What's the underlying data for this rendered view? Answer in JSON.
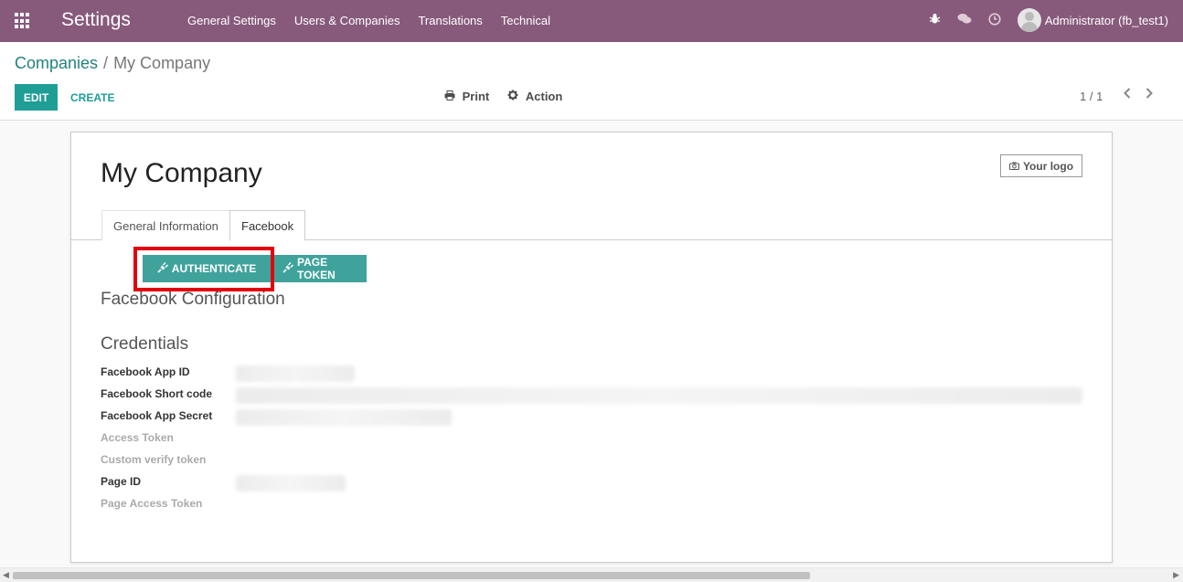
{
  "navbar": {
    "title": "Settings",
    "menu": [
      "General Settings",
      "Users & Companies",
      "Translations",
      "Technical"
    ],
    "user": "Administrator (fb_test1)"
  },
  "breadcrumb": {
    "parent": "Companies",
    "separator": "/",
    "current": "My Company"
  },
  "toolbar": {
    "edit_label": "EDIT",
    "create_label": "CREATE",
    "print_label": "Print",
    "action_label": "Action",
    "pager": "1 / 1"
  },
  "form": {
    "company_name": "My Company",
    "logo_label": "Your logo",
    "tabs": [
      "General Information",
      "Facebook"
    ],
    "buttons": {
      "authenticate": "AUTHENTICATE",
      "page_token": "PAGE TOKEN"
    },
    "section_facebook": "Facebook Configuration",
    "section_credentials": "Credentials",
    "fields": [
      {
        "label": "Facebook App ID"
      },
      {
        "label": "Facebook Short code"
      },
      {
        "label": "Facebook App Secret"
      },
      {
        "label": "Access Token"
      },
      {
        "label": "Custom verify token"
      },
      {
        "label": "Page ID"
      },
      {
        "label": "Page Access Token"
      }
    ]
  },
  "colors": {
    "navbar": "#875a7b",
    "primary": "#1f9e96",
    "highlight": "#e3000f"
  }
}
